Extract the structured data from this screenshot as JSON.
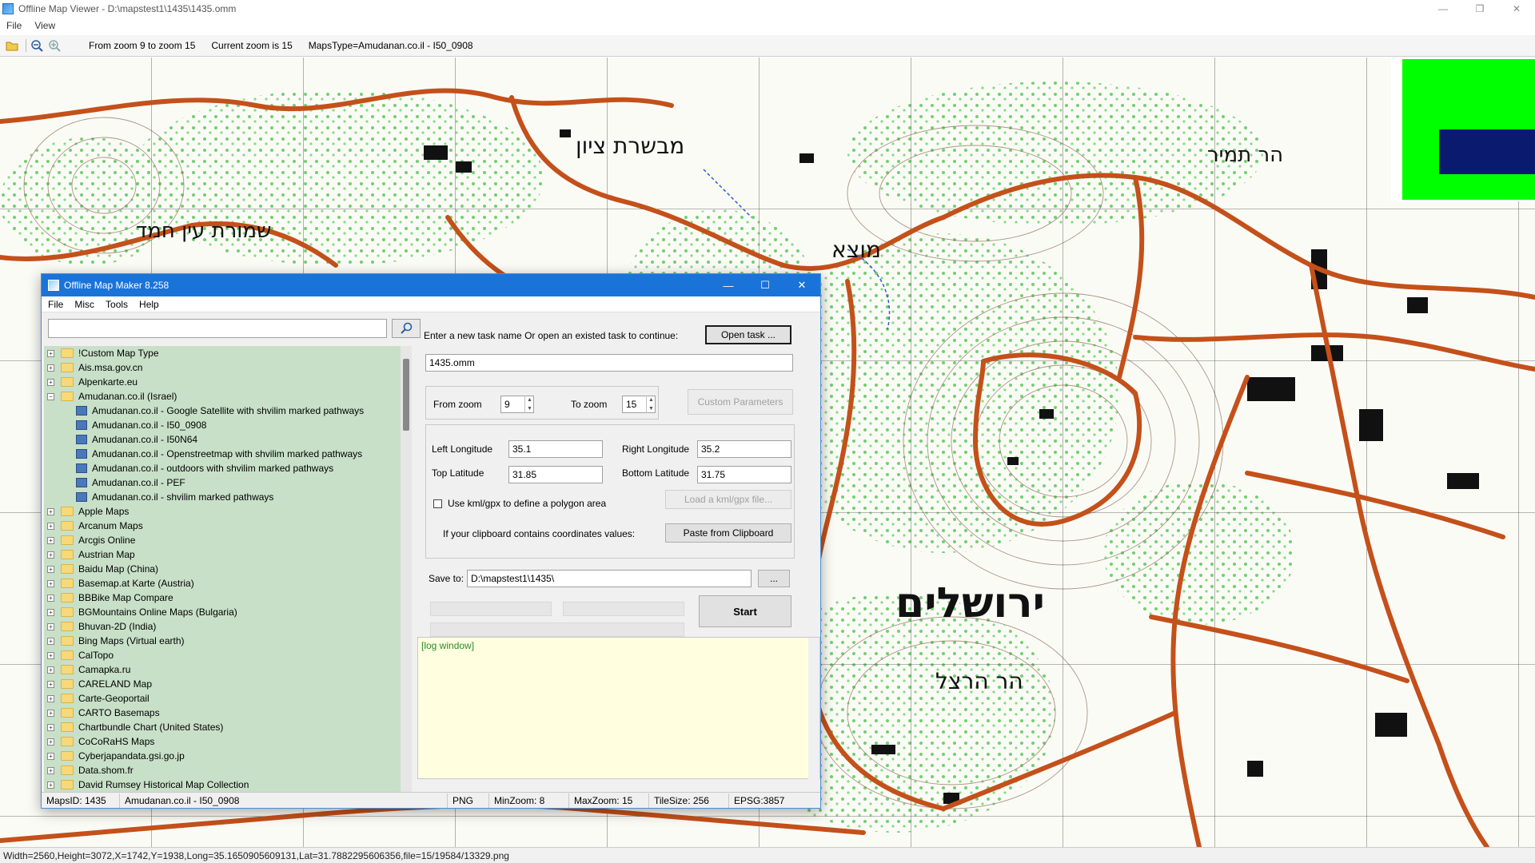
{
  "window": {
    "title": "Offline Map Viewer - D:\\mapstest1\\1435\\1435.omm",
    "menu": [
      "File",
      "View"
    ],
    "toolbar": {
      "zoom_range": "From zoom 9 to zoom 15",
      "current_zoom": "Current zoom is 15",
      "maps_type": "MapsType=Amudanan.co.il - I50_0908"
    },
    "status": "Width=2560,Height=3072,X=1742,Y=1938,Long=35.1650905609131,Lat=31.7882295606356,file=15/19584/13329.png",
    "controls": {
      "minimize": "—",
      "restore": "❐",
      "close": "✕"
    }
  },
  "dialog": {
    "title": "Offline Map Maker 8.258",
    "menu": [
      "File",
      "Misc",
      "Tools",
      "Help"
    ],
    "search": {
      "value": "",
      "placeholder": ""
    },
    "tree": [
      {
        "label": "!Custom Map Type",
        "expanded": false
      },
      {
        "label": "Ais.msa.gov.cn",
        "expanded": false
      },
      {
        "label": "Alpenkarte.eu",
        "expanded": false
      },
      {
        "label": "Amudanan.co.il (Israel)",
        "expanded": true
      },
      {
        "label": "Amudanan.co.il - Google Satellite with shvilim marked pathways",
        "child": true
      },
      {
        "label": "Amudanan.co.il - I50_0908",
        "child": true
      },
      {
        "label": "Amudanan.co.il - I50N64",
        "child": true
      },
      {
        "label": "Amudanan.co.il - Openstreetmap with shvilim marked pathways",
        "child": true
      },
      {
        "label": "Amudanan.co.il - outdoors with shvilim marked pathways",
        "child": true
      },
      {
        "label": "Amudanan.co.il - PEF",
        "child": true
      },
      {
        "label": "Amudanan.co.il - shvilim marked pathways",
        "child": true
      },
      {
        "label": "Apple Maps",
        "expanded": false
      },
      {
        "label": "Arcanum Maps",
        "expanded": false
      },
      {
        "label": "Arcgis Online",
        "expanded": false
      },
      {
        "label": "Austrian Map",
        "expanded": false
      },
      {
        "label": "Baidu Map (China)",
        "expanded": false
      },
      {
        "label": "Basemap.at Karte (Austria)",
        "expanded": false
      },
      {
        "label": "BBBike Map Compare",
        "expanded": false
      },
      {
        "label": "BGMountains Online Maps (Bulgaria)",
        "expanded": false
      },
      {
        "label": "Bhuvan-2D (India)",
        "expanded": false
      },
      {
        "label": "Bing Maps (Virtual earth)",
        "expanded": false
      },
      {
        "label": "CalTopo",
        "expanded": false
      },
      {
        "label": "Camapka.ru",
        "expanded": false
      },
      {
        "label": "CARELAND Map",
        "expanded": false
      },
      {
        "label": "Carte-Geoportail",
        "expanded": false
      },
      {
        "label": "CARTO Basemaps",
        "expanded": false
      },
      {
        "label": "Chartbundle Chart (United States)",
        "expanded": false
      },
      {
        "label": "CoCoRaHS Maps",
        "expanded": false
      },
      {
        "label": "Cyberjapandata.gsi.go.jp",
        "expanded": false
      },
      {
        "label": "Data.shom.fr",
        "expanded": false
      },
      {
        "label": "David Rumsey Historical Map Collection",
        "expanded": false
      }
    ],
    "task": {
      "prompt": "Enter a new task name Or open an existed task to continue:",
      "open_button": "Open task ...",
      "name": "1435.omm"
    },
    "zoom": {
      "from_label": "From zoom",
      "from_value": "9",
      "to_label": "To zoom",
      "to_value": "15",
      "custom_button": "Custom Parameters"
    },
    "coords": {
      "left_lon_label": "Left Longitude",
      "left_lon": "35.1",
      "right_lon_label": "Right Longitude",
      "right_lon": "35.2",
      "top_lat_label": "Top Latitude",
      "top_lat": "31.85",
      "bottom_lat_label": "Bottom Latitude",
      "bottom_lat": "31.75",
      "kml_label": "Use kml/gpx to define a polygon area",
      "kml_button": "Load a kml/gpx file...",
      "clipboard_label": "If your clipboard contains coordinates values:",
      "clipboard_button": "Paste from Clipboard"
    },
    "save": {
      "label": "Save to:",
      "path": "D:\\mapstest1\\1435\\",
      "browse": "..."
    },
    "start_button": "Start",
    "log": "[log window]",
    "status": {
      "maps_id": "MapsID: 1435",
      "maps_name": "Amudanan.co.il - I50_0908",
      "format": "PNG",
      "min_zoom": "MinZoom: 8",
      "max_zoom": "MaxZoom: 15",
      "tile_size": "TileSize: 256",
      "epsg": "EPSG:3857"
    }
  },
  "map_labels": [
    "מבשרת ציון",
    "מוצא",
    "ירושלים",
    "הר הרצל",
    "שמורת עין חמד",
    "הר תמיר"
  ],
  "colors": {
    "dialog_title": "#1a73d9",
    "tree_bg": "#c8e0c8",
    "road": "#c4501a",
    "minimap_green": "#00ff00",
    "minimap_blue": "#0a1a6e"
  }
}
